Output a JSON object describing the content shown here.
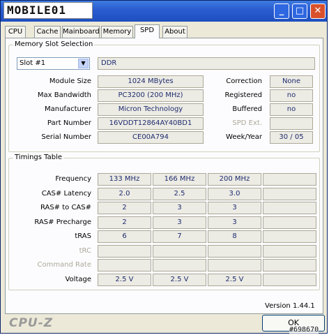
{
  "window": {
    "logo_text": "MOBILE01",
    "title_buttons": {
      "minimize": "_",
      "maximize": "□",
      "close": "✕"
    }
  },
  "tabs": [
    {
      "label": "CPU"
    },
    {
      "label": "Cache"
    },
    {
      "label": "Mainboard"
    },
    {
      "label": "Memory"
    },
    {
      "label": "SPD",
      "active": true
    },
    {
      "label": "About"
    }
  ],
  "memory_slot": {
    "title": "Memory Slot Selection",
    "slot_selected": "Slot #1",
    "type": "DDR",
    "left_labels": [
      "Module Size",
      "Max Bandwidth",
      "Manufacturer",
      "Part Number",
      "Serial Number"
    ],
    "left_values": [
      "1024 MBytes",
      "PC3200 (200 MHz)",
      "Micron Technology",
      "16VDDT12864AY40BD1",
      "CE00A794"
    ],
    "right_labels": [
      "Correction",
      "Registered",
      "Buffered",
      "SPD Ext.",
      "Week/Year"
    ],
    "right_values": [
      "None",
      "no",
      "no",
      "",
      "30 / 05"
    ]
  },
  "timings": {
    "title": "Timings Table",
    "row_labels": [
      "Frequency",
      "CAS# Latency",
      "RAS# to CAS#",
      "RAS# Precharge",
      "tRAS",
      "tRC",
      "Command Rate",
      "Voltage"
    ],
    "rows": [
      [
        "133 MHz",
        "166 MHz",
        "200 MHz",
        ""
      ],
      [
        "2.0",
        "2.5",
        "3.0",
        ""
      ],
      [
        "2",
        "3",
        "3",
        ""
      ],
      [
        "2",
        "3",
        "3",
        ""
      ],
      [
        "6",
        "7",
        "8",
        ""
      ],
      [
        "",
        "",
        "",
        ""
      ],
      [
        "",
        "",
        "",
        ""
      ],
      [
        "2.5 V",
        "2.5 V",
        "2.5 V",
        ""
      ]
    ]
  },
  "footer": {
    "version": "Version 1.44.1",
    "brand": "CPU-Z",
    "ok_label": "OK",
    "watermark": "#698670"
  }
}
